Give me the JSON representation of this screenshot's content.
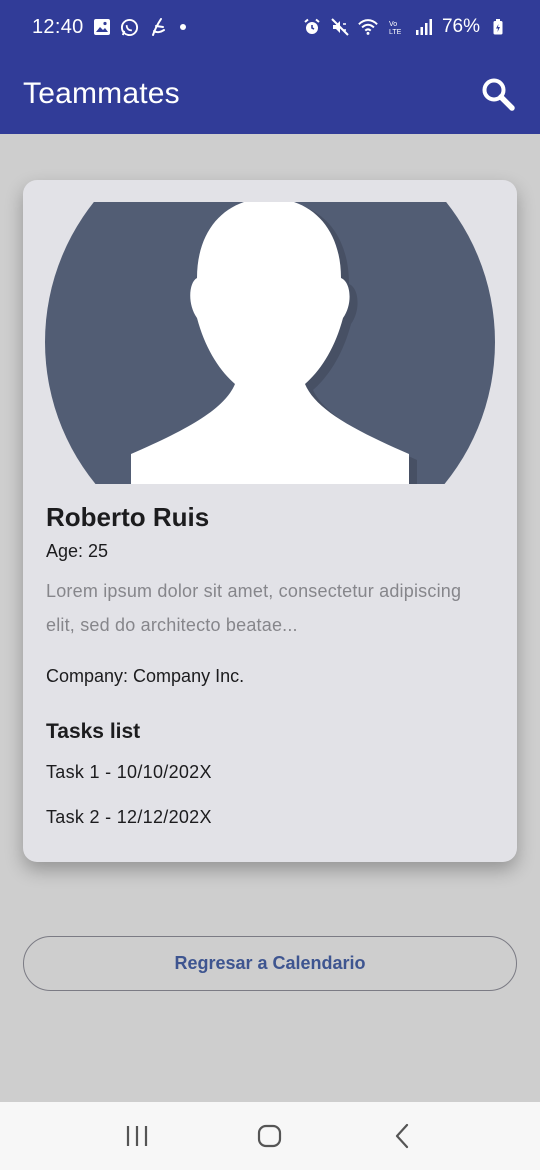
{
  "status_bar": {
    "time": "12:40",
    "battery": "76%",
    "left_icons": [
      "gallery-icon",
      "whatsapp-icon",
      "app-icon",
      "dot-icon"
    ],
    "right_icons": [
      "alarm-icon",
      "mute-icon",
      "wifi-icon",
      "volte-icon",
      "signal-icon",
      "battery-icon"
    ]
  },
  "app_bar": {
    "title": "Teammates",
    "search_icon": "search-icon",
    "background_color": "#313c98"
  },
  "profile": {
    "avatar_icon": "person-avatar-icon",
    "name": "Roberto Ruis",
    "age": "Age: 25",
    "description": "Lorem ipsum dolor sit amet, consectetur adipiscing elit, sed do architecto beatae...",
    "company": "Company: Company Inc.",
    "tasks_heading": "Tasks list",
    "tasks": [
      "Task 1 - 10/10/202X",
      "Task 2 - 12/12/202X"
    ]
  },
  "actions": {
    "back_label": "Regresar a Calendario",
    "accent_color": "#3e5590"
  },
  "nav_bar": {
    "recents_icon": "recents-icon",
    "home_icon": "home-icon",
    "back_icon": "back-icon"
  }
}
